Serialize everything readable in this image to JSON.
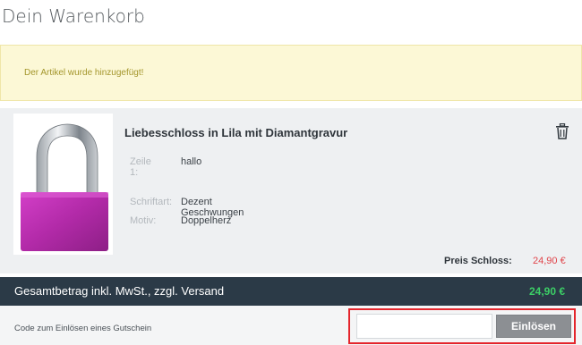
{
  "page": {
    "title": "Dein Warenkorb"
  },
  "notice": {
    "text": "Der Artikel wurde hinzugefügt!"
  },
  "item": {
    "name": "Liebesschloss in Lila mit Diamantgravur",
    "image_icon": "padlock-purple-image",
    "remove_icon": "trash-icon",
    "details": [
      {
        "label": "Zeile 1:",
        "value": "hallo"
      },
      {
        "label": "Schriftart:",
        "value": "Dezent Geschwungen"
      },
      {
        "label": "Motiv:",
        "value": "Doppelherz"
      }
    ],
    "price_label": "Preis Schloss:",
    "price_value": "24,90 €"
  },
  "total": {
    "label": "Gesamtbetrag inkl. MwSt., zzgl. Versand",
    "value": "24,90 €"
  },
  "voucher": {
    "label": "Code zum Einlösen eines Gutschein",
    "input_value": "",
    "button_label": "Einlösen"
  },
  "colors": {
    "notice_bg": "#fcf8d6",
    "notice_text": "#a4962c",
    "price": "#e0444a",
    "total_bar": "#2b3a47",
    "total_value": "#3ccf66",
    "highlight_border": "#e4252c",
    "button": "#8c8f93"
  }
}
